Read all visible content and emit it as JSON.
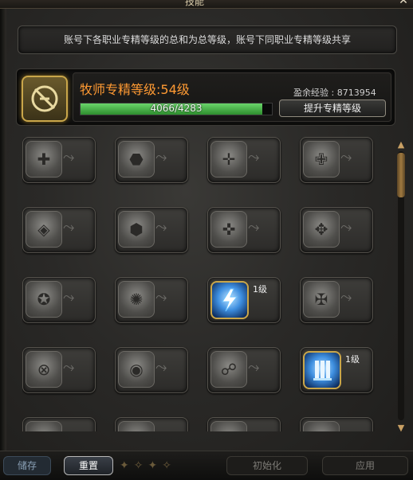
{
  "window": {
    "title": "技能"
  },
  "notice": {
    "text": "账号下各职业专精等级的总和为总等级，账号下同职业专精等级共享"
  },
  "summary": {
    "level_title": "牧师专精等级:54级",
    "progress_text": "4066/4283",
    "progress_current": 4066,
    "progress_max": 4283,
    "exp_label": "盈余经验 : 8713954",
    "upgrade_button": "提升专精等级"
  },
  "skills": [
    {
      "icon": "skill-icon",
      "level": ""
    },
    {
      "icon": "skill-icon",
      "level": ""
    },
    {
      "icon": "skill-icon",
      "level": ""
    },
    {
      "icon": "skill-icon",
      "level": ""
    },
    {
      "icon": "skill-icon",
      "level": ""
    },
    {
      "icon": "skill-icon",
      "level": ""
    },
    {
      "icon": "skill-icon",
      "level": ""
    },
    {
      "icon": "skill-icon",
      "level": ""
    },
    {
      "icon": "skill-icon",
      "level": ""
    },
    {
      "icon": "skill-icon",
      "level": ""
    },
    {
      "icon": "lightning-skill-icon",
      "level": "1级",
      "active": true
    },
    {
      "icon": "skill-icon",
      "level": ""
    },
    {
      "icon": "skill-icon",
      "level": ""
    },
    {
      "icon": "skill-icon",
      "level": ""
    },
    {
      "icon": "skill-icon",
      "level": ""
    },
    {
      "icon": "pillar-skill-icon",
      "level": "1级",
      "active": true
    },
    {
      "icon": "skill-icon",
      "level": ""
    },
    {
      "icon": "skill-icon",
      "level": ""
    },
    {
      "icon": "skill-icon",
      "level": ""
    },
    {
      "icon": "skill-icon",
      "level": ""
    }
  ],
  "bottom": {
    "save": "储存",
    "reset": "重置",
    "init": "初始化",
    "apply": "应用"
  },
  "colors": {
    "accent_orange": "#ff9a33",
    "progress_green": "#3fb13f",
    "gold_border": "#c9a64a"
  }
}
